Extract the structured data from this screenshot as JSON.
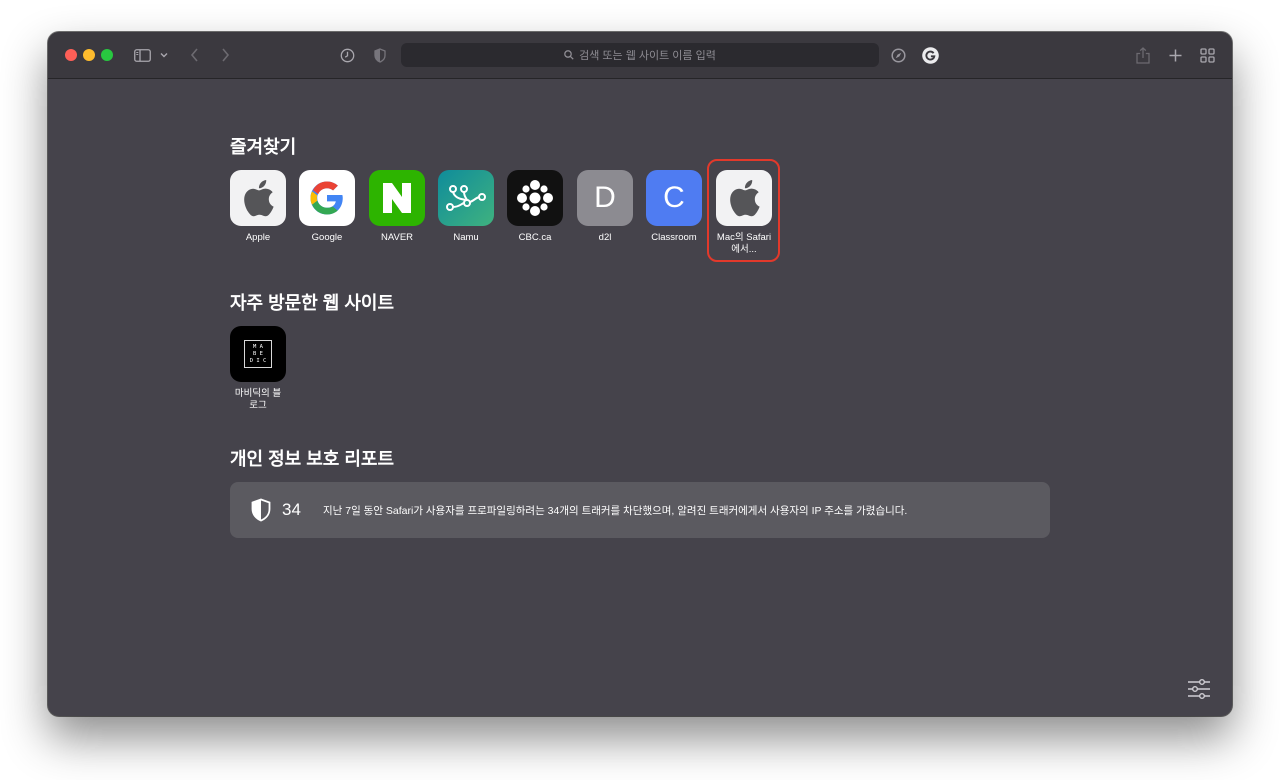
{
  "search": {
    "placeholder": "검색 또는 웹 사이트 이름 입력"
  },
  "favorites": {
    "title": "즐겨찾기",
    "items": [
      {
        "label": "Apple",
        "icon": "apple-logo-icon",
        "bg": "#f2f2f3"
      },
      {
        "label": "Google",
        "icon": "google-logo-icon",
        "bg": "#ffffff"
      },
      {
        "label": "NAVER",
        "icon": "naver-logo-icon",
        "bg": "#2db400"
      },
      {
        "label": "Namu",
        "icon": "namu-logo-icon",
        "bg": "#1f9b86"
      },
      {
        "label": "CBC.ca",
        "icon": "cbc-logo-icon",
        "bg": "#111111"
      },
      {
        "label": "d2l",
        "icon": "letter-d-icon",
        "letter": "D",
        "bg": "#8c8b91"
      },
      {
        "label": "Classroom",
        "icon": "letter-c-icon",
        "letter": "C",
        "bg": "#4f7cf2"
      },
      {
        "label": "Mac의 Safari에서...",
        "icon": "apple-logo-icon",
        "bg": "#f2f2f3"
      }
    ]
  },
  "frequent": {
    "title": "자주 방문한 웹 사이트",
    "items": [
      {
        "label": "마비딕의 블로그",
        "icon": "mabedic-logo-icon",
        "logo_text": [
          "M A",
          "B E",
          "D I C"
        ],
        "bg": "#000000"
      }
    ]
  },
  "privacy": {
    "title": "개인 정보 보호 리포트",
    "count": "34",
    "text": "지난 7일 동안 Safari가 사용자를 프로파일링하려는 34개의 트래커를 차단했으며, 알려진 트래커에게서 사용자의 IP 주소를 가렸습니다."
  },
  "colors": {
    "highlight": "#e2392b",
    "window_bg": "#45434b"
  }
}
